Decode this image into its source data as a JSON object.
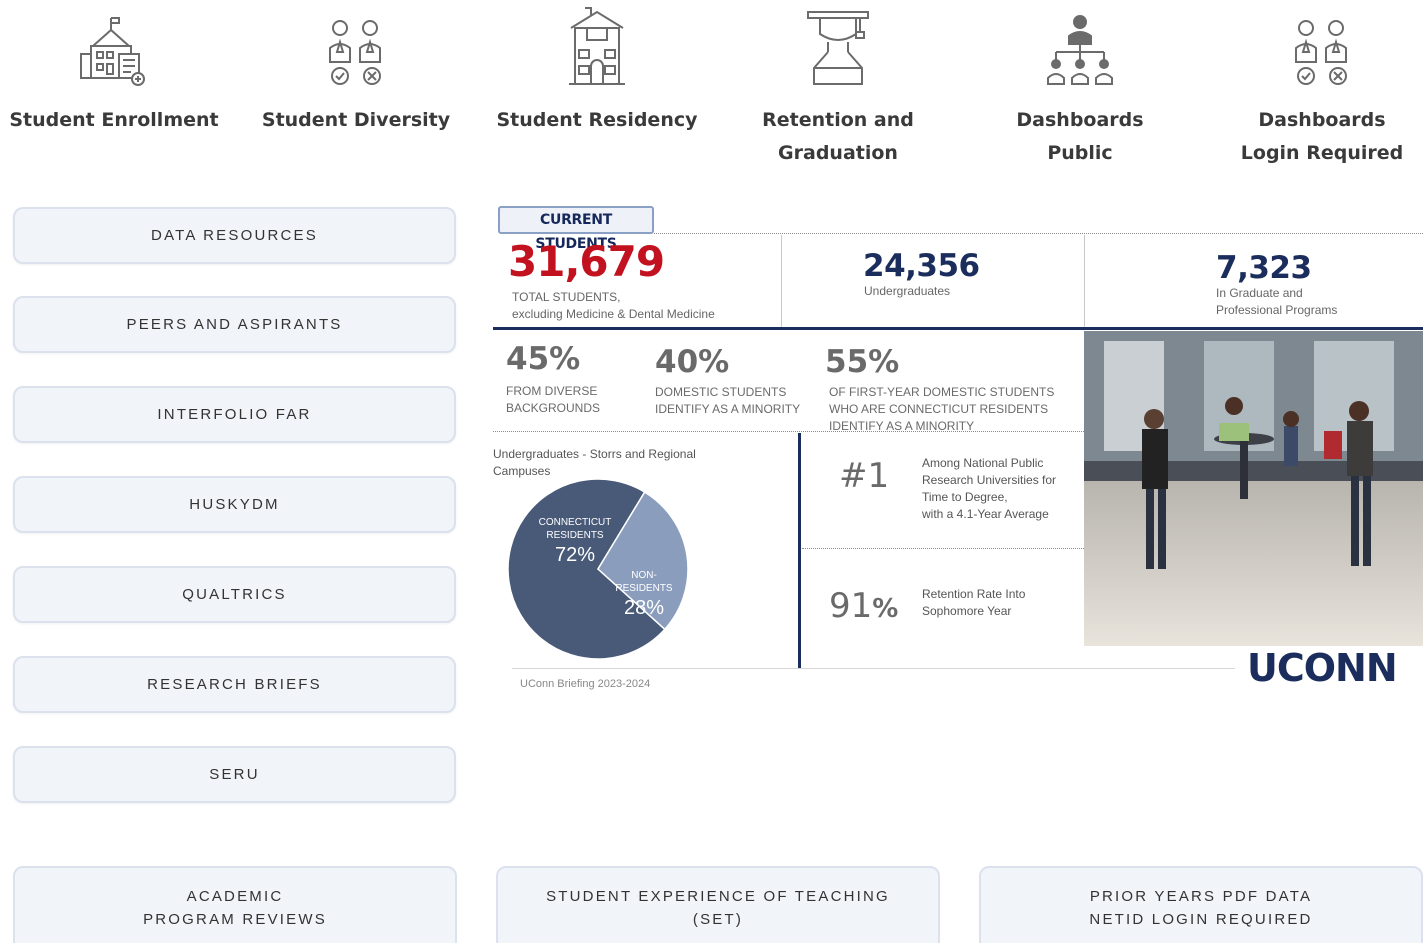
{
  "top_nav": [
    {
      "icon": "school-building-icon",
      "label": [
        "Student Enrollment"
      ]
    },
    {
      "icon": "people-check-icon",
      "label": [
        "Student Diversity"
      ]
    },
    {
      "icon": "house-icon",
      "label": [
        "Student Residency"
      ]
    },
    {
      "icon": "graduation-cap-icon",
      "label": [
        "Retention and",
        "Graduation"
      ]
    },
    {
      "icon": "org-chart-icon",
      "label": [
        "Dashboards",
        "Public"
      ]
    },
    {
      "icon": "people-check-icon",
      "label": [
        "Dashboards",
        "Login Required"
      ]
    }
  ],
  "side_buttons": [
    "DATA RESOURCES",
    "PEERS AND ASPIRANTS",
    "INTERFOLIO FAR",
    "HUSKYDM",
    "QUALTRICS",
    "RESEARCH BRIEFS",
    "SERU"
  ],
  "bottom_buttons": [
    {
      "line1": "ACADEMIC",
      "line2": "PROGRAM REVIEWS"
    },
    {
      "line1": "STUDENT EXPERIENCE OF TEACHING",
      "line2": "(SET)"
    },
    {
      "line1": "PRIOR YEARS PDF DATA",
      "line2": "NETID LOGIN REQUIRED"
    }
  ],
  "infographic": {
    "badge": "CURRENT STUDENTS",
    "total": {
      "value": "31,679",
      "caption1": "TOTAL STUDENTS,",
      "caption2": "excluding Medicine & Dental Medicine"
    },
    "undergrad": {
      "value": "24,356",
      "caption": "Undergraduates"
    },
    "graduate": {
      "value": "7,323",
      "caption1": "In Graduate and",
      "caption2": "Professional Programs"
    },
    "stats": [
      {
        "value": "45%",
        "caption1": "FROM  DIVERSE",
        "caption2": "BACKGROUNDS",
        "caption3": ""
      },
      {
        "value": "40%",
        "caption1": "DOMESTIC STUDENTS",
        "caption2": "IDENTIFY AS A MINORITY",
        "caption3": ""
      },
      {
        "value": "55%",
        "caption1": "OF FIRST-YEAR DOMESTIC STUDENTS",
        "caption2": "WHO ARE CONNECTICUT RESIDENTS",
        "caption3": "IDENTIFY AS A MINORITY"
      }
    ],
    "pie": {
      "title": "Undergraduates - Storrs and Regional Campuses",
      "residents_label1": "CONNECTICUT",
      "residents_label2": "RESIDENTS",
      "residents_value": "72%",
      "nonres_label1": "NON-",
      "nonres_label2": "RESIDENTS",
      "nonres_value": "28%",
      "colors": {
        "residents": "#485a78",
        "nonresidents": "#8a9dbc"
      }
    },
    "rank": {
      "value": "#1",
      "caption1": "Among National Public",
      "caption2": "Research Universities for",
      "caption3": "Time to Degree,",
      "caption4": "with a 4.1-Year Average"
    },
    "retention": {
      "value": "91",
      "suffix": "%",
      "caption1": "Retention Rate Into",
      "caption2": "Sophomore Year"
    },
    "logo": "UCONN",
    "footer": "UConn Briefing 2023-2024"
  },
  "chart_data": {
    "type": "pie",
    "title": "Undergraduates - Storrs and Regional Campuses",
    "categories": [
      "CONNECTICUT RESIDENTS",
      "NON-RESIDENTS"
    ],
    "values": [
      72,
      28
    ]
  }
}
